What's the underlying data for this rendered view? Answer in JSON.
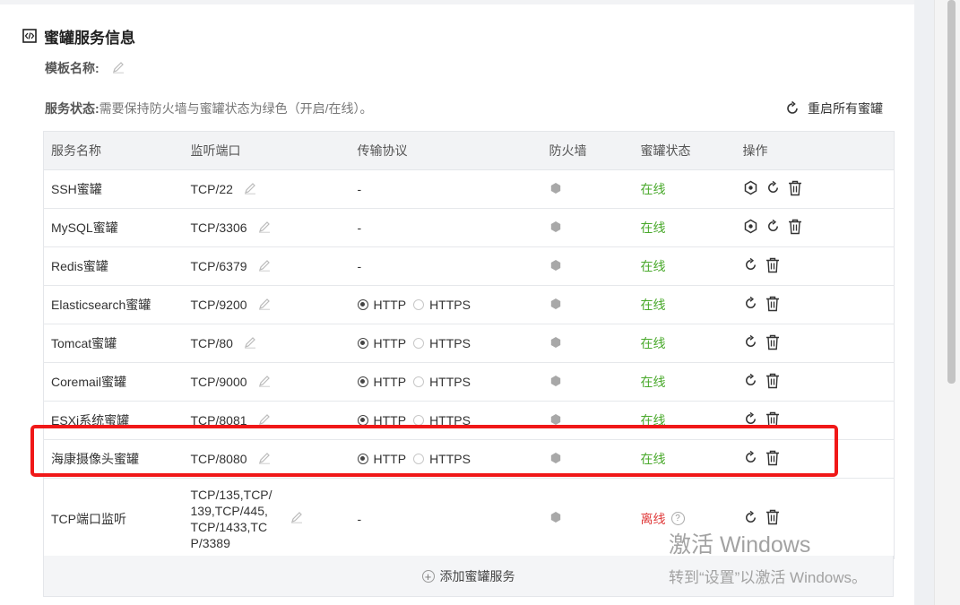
{
  "section": {
    "title": "蜜罐服务信息",
    "icon": "code-icon"
  },
  "template": {
    "label": "模板名称:"
  },
  "status": {
    "label": "服务状态:",
    "description": "需要保持防火墙与蜜罐状态为绿色（开启/在线）。",
    "restart_all_label": "重启所有蜜罐"
  },
  "table": {
    "headers": {
      "name": "服务名称",
      "port": "监听端口",
      "protocol": "传输协议",
      "firewall": "防火墙",
      "status": "蜜罐状态",
      "actions": "操作"
    },
    "protocol_options": {
      "http": "HTTP",
      "https": "HTTPS"
    },
    "rows": [
      {
        "name": "SSH蜜罐",
        "port": "TCP/22",
        "protocol": "-",
        "status": "在线"
      },
      {
        "name": "MySQL蜜罐",
        "port": "TCP/3306",
        "protocol": "-",
        "status": "在线"
      },
      {
        "name": "Redis蜜罐",
        "port": "TCP/6379",
        "protocol": "-",
        "status": "在线"
      },
      {
        "name": "Elasticsearch蜜罐",
        "port": "TCP/9200",
        "status": "在线"
      },
      {
        "name": "Tomcat蜜罐",
        "port": "TCP/80",
        "status": "在线"
      },
      {
        "name": "Coremail蜜罐",
        "port": "TCP/9000",
        "status": "在线"
      },
      {
        "name": "ESXi系统蜜罐",
        "port": "TCP/8081",
        "status": "在线"
      },
      {
        "name": "海康摄像头蜜罐",
        "port": "TCP/8080",
        "status": "在线"
      },
      {
        "name": "TCP端口监听",
        "port_lines": [
          "TCP/135,TCP/",
          "139,TCP/445,",
          "TCP/1433,TC",
          "P/3389"
        ],
        "protocol": "-",
        "status": "离线"
      }
    ]
  },
  "add_service_label": "添加蜜罐服务",
  "colors": {
    "online": "#49a92b",
    "offline": "#e03b3b",
    "highlight": "#f01818"
  },
  "watermark": {
    "line1": "激活 Windows",
    "line2": "转到“设置”以激活 Windows。"
  }
}
